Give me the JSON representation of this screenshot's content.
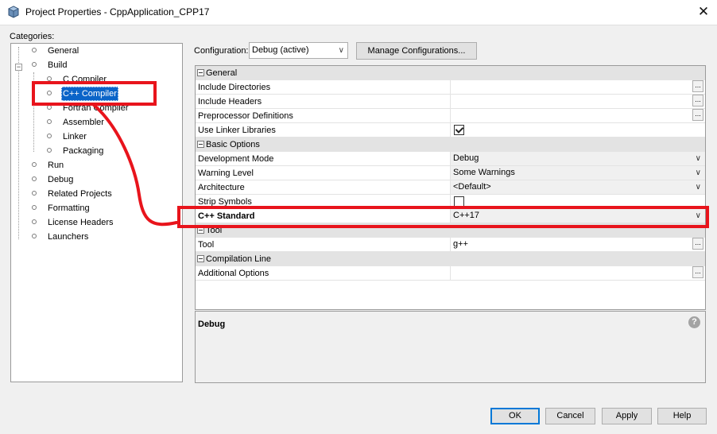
{
  "window": {
    "title": "Project Properties - CppApplication_CPP17"
  },
  "categories": {
    "label": "Categories:",
    "items": [
      {
        "label": "General"
      },
      {
        "label": "Build"
      },
      {
        "label": "C Compiler"
      },
      {
        "label": "C++ Compiler"
      },
      {
        "label": "Fortran Compiler"
      },
      {
        "label": "Assembler"
      },
      {
        "label": "Linker"
      },
      {
        "label": "Packaging"
      },
      {
        "label": "Run"
      },
      {
        "label": "Debug"
      },
      {
        "label": "Related Projects"
      },
      {
        "label": "Formatting"
      },
      {
        "label": "License Headers"
      },
      {
        "label": "Launchers"
      }
    ],
    "selected": "C++ Compiler"
  },
  "configuration": {
    "label": "Configuration:",
    "value": "Debug (active)",
    "manage_label": "Manage Configurations..."
  },
  "properties": {
    "sections": [
      {
        "name": "General",
        "rows": [
          {
            "name": "Include Directories",
            "value": "",
            "editor": "ellipsis"
          },
          {
            "name": "Include Headers",
            "value": "",
            "editor": "ellipsis"
          },
          {
            "name": "Preprocessor Definitions",
            "value": "",
            "editor": "ellipsis"
          },
          {
            "name": "Use Linker Libraries",
            "value": "",
            "editor": "checkbox",
            "checked": true
          }
        ]
      },
      {
        "name": "Basic Options",
        "rows": [
          {
            "name": "Development Mode",
            "value": "Debug",
            "editor": "combo"
          },
          {
            "name": "Warning Level",
            "value": "Some Warnings",
            "editor": "combo"
          },
          {
            "name": "Architecture",
            "value": "<Default>",
            "editor": "combo"
          },
          {
            "name": "Strip Symbols",
            "value": "",
            "editor": "checkbox",
            "checked": false
          },
          {
            "name": "C++ Standard",
            "value": "C++17",
            "editor": "combo",
            "bold": true
          }
        ]
      },
      {
        "name": "Tool",
        "rows": [
          {
            "name": "Tool",
            "value": "g++",
            "editor": "ellipsis"
          }
        ]
      },
      {
        "name": "Compilation Line",
        "rows": [
          {
            "name": "Additional Options",
            "value": "",
            "editor": "ellipsis"
          }
        ]
      }
    ]
  },
  "description": {
    "title": "Debug"
  },
  "buttons": {
    "ok": "OK",
    "cancel": "Cancel",
    "apply": "Apply",
    "help": "Help"
  },
  "colors": {
    "highlight": "#e8141c",
    "selection": "#0a64c8",
    "focus": "#0078d7"
  }
}
